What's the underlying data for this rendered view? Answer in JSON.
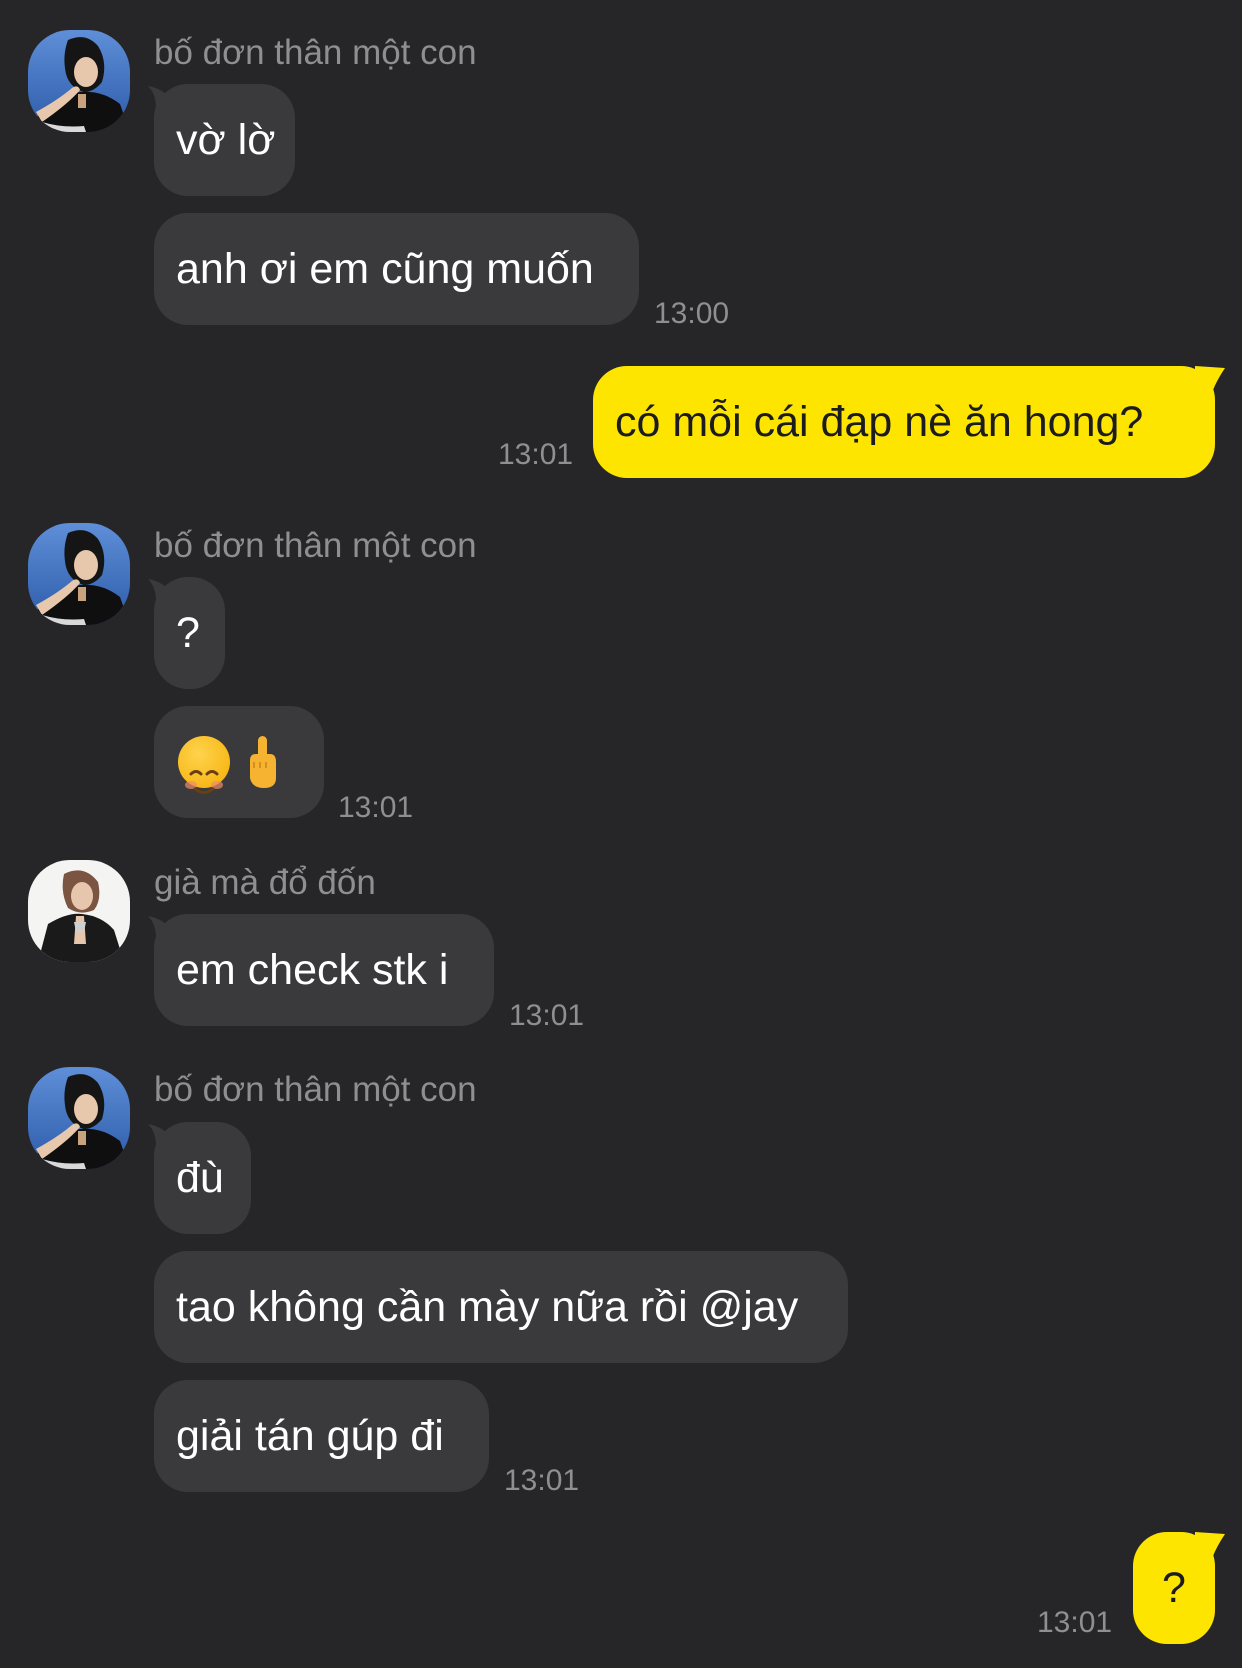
{
  "colors": {
    "background": "#262628",
    "incoming_bubble": "#3a3a3c",
    "outgoing_bubble": "#fee500",
    "meta_text": "#8e8e93"
  },
  "messages": {
    "g1": {
      "sender": "bố đơn thân một con",
      "m1": "vờ lờ",
      "m2": "anh ơi em cũng muốn",
      "time": "13:00"
    },
    "me1": {
      "text": "có mỗi cái đạp nè ăn hong?",
      "time": "13:01"
    },
    "g2": {
      "sender": "bố đơn thân một con",
      "m1": "?",
      "m2_emoji": [
        "smiling-face-emoji",
        "middle-finger-emoji"
      ],
      "time": "13:01"
    },
    "g3": {
      "sender": "già mà đổ đốn",
      "m1": "em check stk i",
      "time": "13:01"
    },
    "g4": {
      "sender": "bố đơn thân một con",
      "m1": "đù",
      "m2": "tao không cần mày nữa rồi @jay",
      "m3": "giải tán gúp đi",
      "time": "13:01"
    },
    "me2": {
      "text": "?",
      "time": "13:01"
    }
  }
}
